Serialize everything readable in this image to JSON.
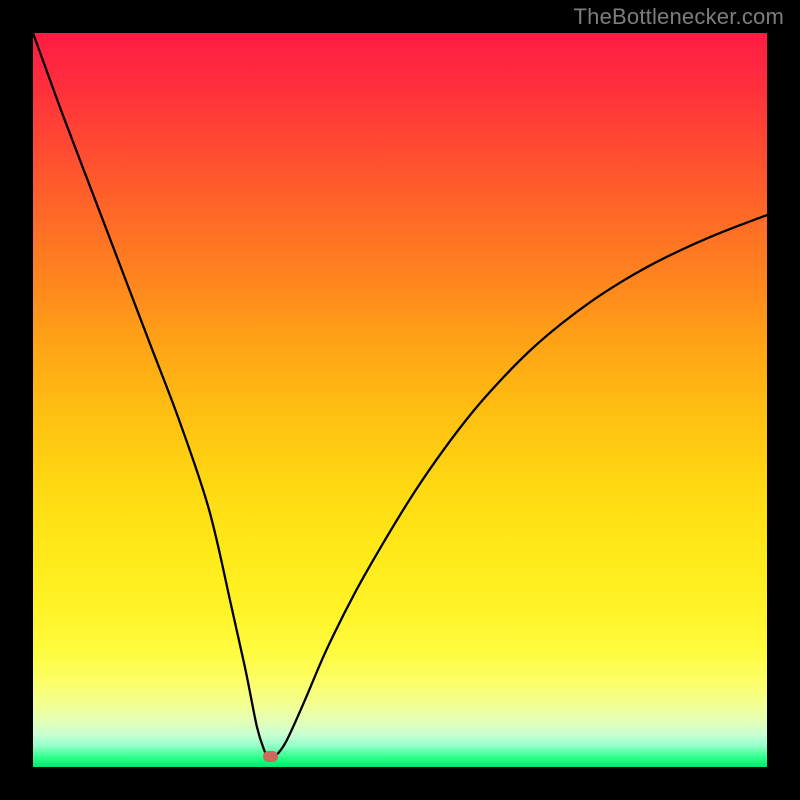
{
  "watermark": {
    "text": "TheBottlenecker.com"
  },
  "chart_data": {
    "type": "line",
    "title": "",
    "xlabel": "",
    "ylabel": "",
    "xlim": [
      0,
      100
    ],
    "ylim": [
      0,
      100
    ],
    "grid": false,
    "legend": false,
    "x": [
      0,
      4,
      8,
      12,
      16,
      20,
      24,
      27,
      29,
      30.5,
      31.5,
      32,
      33,
      34.5,
      37,
      40,
      44,
      48,
      52,
      56,
      60,
      64,
      68,
      72,
      76,
      80,
      84,
      88,
      92,
      96,
      100
    ],
    "values": [
      100,
      89,
      78.5,
      68,
      57.5,
      47,
      35,
      22,
      13,
      5.5,
      2.3,
      1.5,
      1.5,
      3.5,
      9,
      16,
      24,
      31,
      37.5,
      43.3,
      48.5,
      53,
      57,
      60.4,
      63.4,
      66,
      68.3,
      70.3,
      72.1,
      73.7,
      75.2
    ],
    "marker": {
      "x": 32.3,
      "y": 1.4
    },
    "gradient_colors": {
      "top": "#ff1c43",
      "mid_high": "#ff861e",
      "mid": "#ffe818",
      "low_mid": "#fdff63",
      "bottom": "#00e86a"
    }
  }
}
